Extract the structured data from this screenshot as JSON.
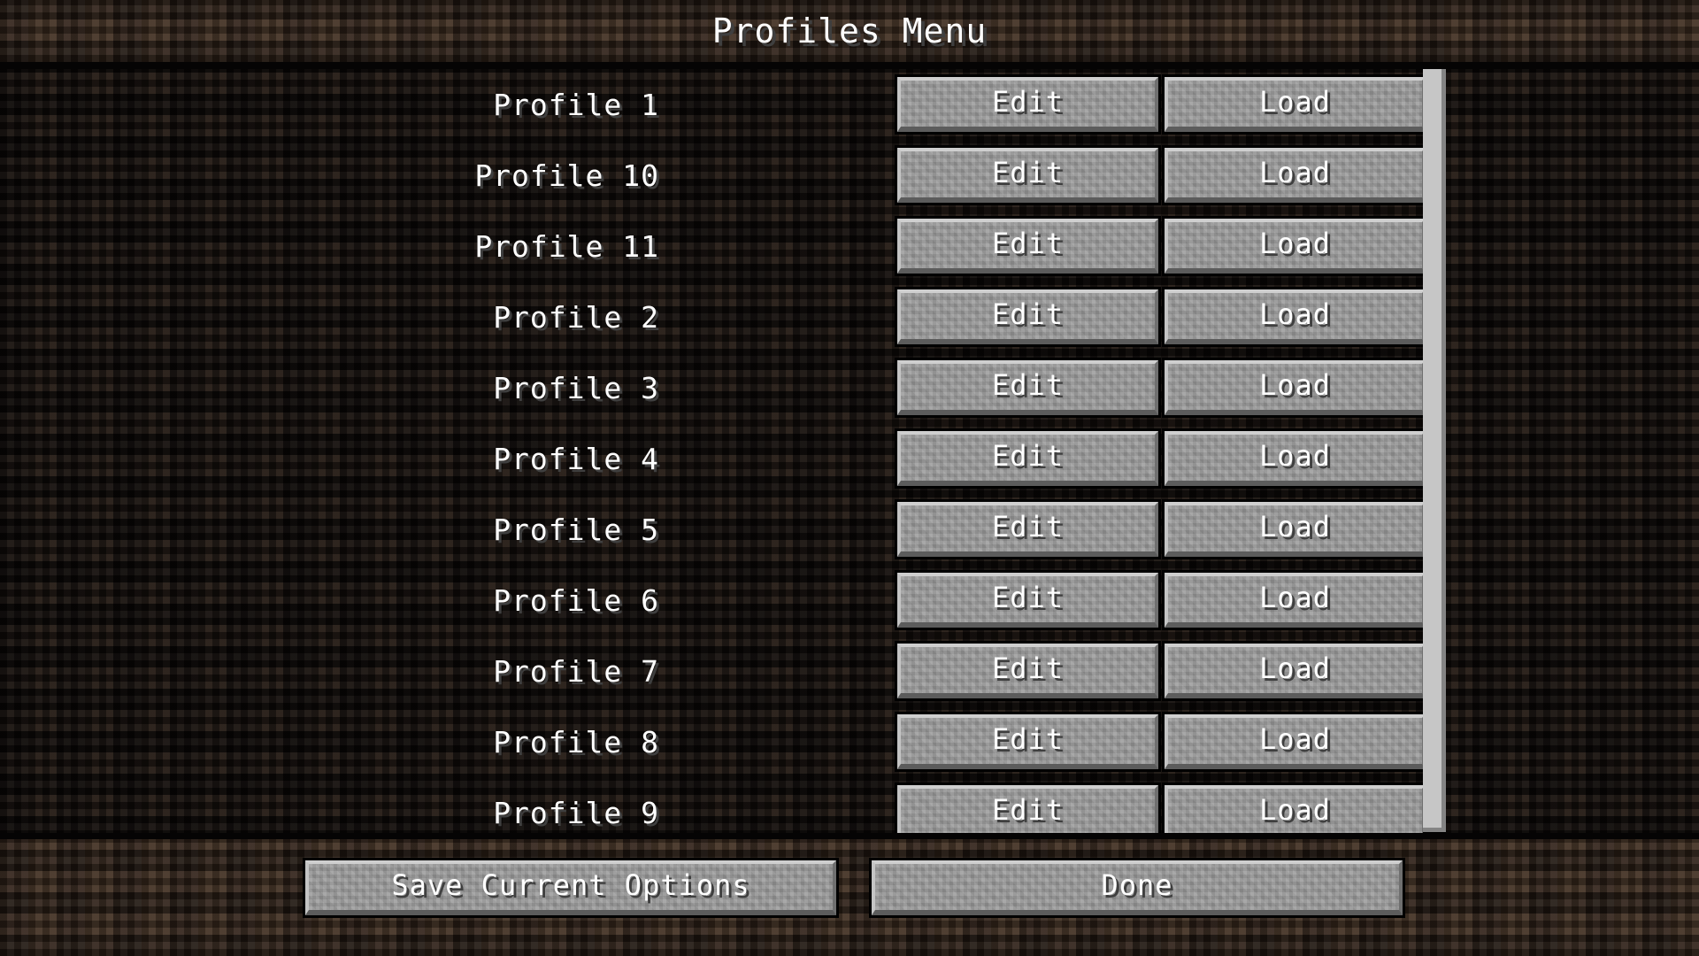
{
  "header": {
    "title": "Profiles Menu"
  },
  "list": {
    "row_action_edit": "Edit",
    "row_action_load": "Load",
    "rows": [
      {
        "name": "Profile 1",
        "edit": "Edit",
        "load": "Load"
      },
      {
        "name": "Profile 10",
        "edit": "Edit",
        "load": "Load"
      },
      {
        "name": "Profile 11",
        "edit": "Edit",
        "load": "Load"
      },
      {
        "name": "Profile 2",
        "edit": "Edit",
        "load": "Load"
      },
      {
        "name": "Profile 3",
        "edit": "Edit",
        "load": "Load"
      },
      {
        "name": "Profile 4",
        "edit": "Edit",
        "load": "Load"
      },
      {
        "name": "Profile 5",
        "edit": "Edit",
        "load": "Load"
      },
      {
        "name": "Profile 6",
        "edit": "Edit",
        "load": "Load"
      },
      {
        "name": "Profile 7",
        "edit": "Edit",
        "load": "Load"
      },
      {
        "name": "Profile 8",
        "edit": "Edit",
        "load": "Load"
      },
      {
        "name": "Profile 9",
        "edit": "Edit",
        "load": "Load"
      }
    ]
  },
  "scrollbar": {
    "orientation": "vertical",
    "thumb_position_percent": 0
  },
  "footer": {
    "save_label": "Save Current Options",
    "done_label": "Done"
  },
  "colors": {
    "button_face": "#9a9a9a",
    "button_highlight": "#cfcfcf",
    "button_shadow": "#5c5c5c",
    "text": "#ffffff",
    "text_shadow": "#3f3f3f",
    "scrollbar_thumb": "#c6c6c6",
    "scrollbar_track": "#000000",
    "header_dirt": "#33251b",
    "body_dirt": "#1b1410"
  }
}
